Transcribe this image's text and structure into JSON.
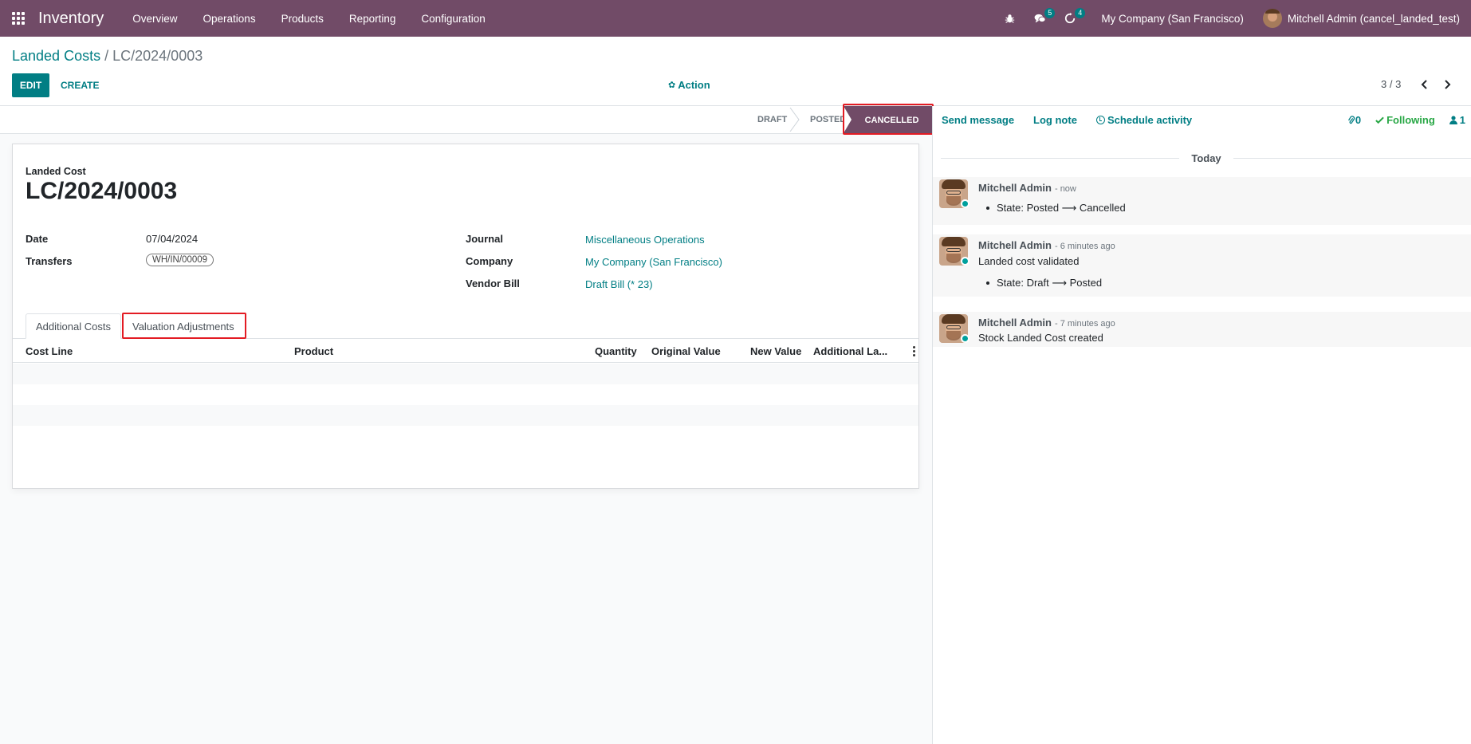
{
  "navbar": {
    "app_name": "Inventory",
    "menu": [
      "Overview",
      "Operations",
      "Products",
      "Reporting",
      "Configuration"
    ],
    "bug_icon": "bug-icon",
    "messages_count": "5",
    "activities_count": "4",
    "company": "My Company (San Francisco)",
    "user": "Mitchell Admin (cancel_landed_test)",
    "brand_color": "#714b67"
  },
  "breadcrumb": {
    "parent": "Landed Costs",
    "separator": "/",
    "current": "LC/2024/0003"
  },
  "buttons": {
    "edit": "EDIT",
    "create": "CREATE",
    "action": "Action"
  },
  "pager": {
    "value": "3 / 3"
  },
  "status": {
    "stages": [
      "DRAFT",
      "POSTED",
      "CANCELLED"
    ],
    "current": "CANCELLED"
  },
  "form": {
    "label": "Landed Cost",
    "title": "LC/2024/0003",
    "date_label": "Date",
    "date_value": "07/04/2024",
    "transfers_label": "Transfers",
    "transfers_value": "WH/IN/00009",
    "journal_label": "Journal",
    "journal_value": "Miscellaneous Operations",
    "company_label": "Company",
    "company_value": "My Company (San Francisco)",
    "vendor_bill_label": "Vendor Bill",
    "vendor_bill_value": "Draft Bill (* 23)"
  },
  "tabs": [
    "Additional Costs",
    "Valuation Adjustments"
  ],
  "active_tab": "Valuation Adjustments",
  "table": {
    "columns": [
      "Cost Line",
      "Product",
      "Quantity",
      "Original Value",
      "New Value",
      "Additional La..."
    ],
    "rows": []
  },
  "chatter": {
    "send_message": "Send message",
    "log_note": "Log note",
    "schedule_activity": "Schedule activity",
    "attachments": "0",
    "following": "Following",
    "followers": "1",
    "date_separator": "Today",
    "messages": [
      {
        "author": "Mitchell Admin",
        "when": "- now",
        "body": "",
        "tracking": "State: Posted ⟶ Cancelled"
      },
      {
        "author": "Mitchell Admin",
        "when": "- 6 minutes ago",
        "body": "Landed cost validated",
        "tracking": "State: Draft ⟶ Posted"
      },
      {
        "author": "Mitchell Admin",
        "when": "- 7 minutes ago",
        "body": "Stock Landed Cost created",
        "tracking": ""
      }
    ]
  }
}
